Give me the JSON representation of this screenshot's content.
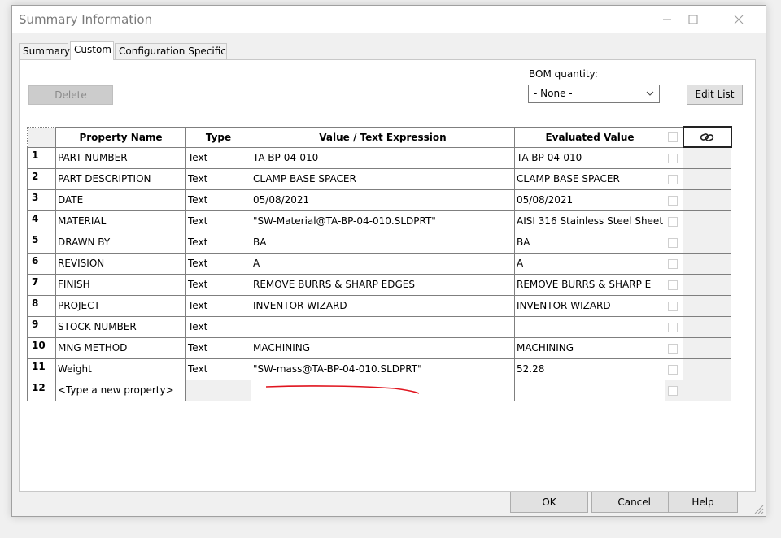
{
  "window": {
    "title": "Summary Information"
  },
  "tabs": [
    {
      "label": "Summary",
      "active": false
    },
    {
      "label": "Custom",
      "active": true
    },
    {
      "label": "Configuration Specific",
      "active": false
    }
  ],
  "toolbar": {
    "delete_label": "Delete",
    "bom_label": "BOM quantity:",
    "bom_value": "- None -",
    "edit_list_label": "Edit List"
  },
  "table": {
    "headers": {
      "num": "",
      "name": "Property Name",
      "type": "Type",
      "value": "Value / Text Expression",
      "evaluated": "Evaluated Value",
      "link_icon": "link-icon"
    },
    "rows": [
      {
        "num": "1",
        "name": "PART NUMBER",
        "type": "Text",
        "value": "TA-BP-04-010",
        "evaluated": "TA-BP-04-010"
      },
      {
        "num": "2",
        "name": "PART DESCRIPTION",
        "type": "Text",
        "value": "CLAMP BASE SPACER",
        "evaluated": "CLAMP BASE SPACER"
      },
      {
        "num": "3",
        "name": "DATE",
        "type": "Text",
        "value": "05/08/2021",
        "evaluated": "05/08/2021"
      },
      {
        "num": "4",
        "name": "MATERIAL",
        "type": "Text",
        "value": "\"SW-Material@TA-BP-04-010.SLDPRT\"",
        "evaluated": "AISI 316 Stainless Steel Sheet"
      },
      {
        "num": "5",
        "name": "DRAWN BY",
        "type": "Text",
        "value": "BA",
        "evaluated": "BA"
      },
      {
        "num": "6",
        "name": "REVISION",
        "type": "Text",
        "value": "A",
        "evaluated": "A"
      },
      {
        "num": "7",
        "name": "FINISH",
        "type": "Text",
        "value": "REMOVE BURRS & SHARP EDGES",
        "evaluated": "REMOVE BURRS & SHARP E"
      },
      {
        "num": "8",
        "name": "PROJECT",
        "type": "Text",
        "value": "INVENTOR WIZARD",
        "evaluated": "INVENTOR WIZARD"
      },
      {
        "num": "9",
        "name": "STOCK NUMBER",
        "type": "Text",
        "value": "",
        "evaluated": ""
      },
      {
        "num": "10",
        "name": "MNG METHOD",
        "type": "Text",
        "value": "MACHINING",
        "evaluated": "MACHINING"
      },
      {
        "num": "11",
        "name": "Weight",
        "type": "Text",
        "value": "\"SW-mass@TA-BP-04-010.SLDPRT\"",
        "evaluated": "52.28"
      },
      {
        "num": "12",
        "name": "<Type a new property>",
        "type": "",
        "value": "",
        "evaluated": ""
      }
    ]
  },
  "footer": {
    "ok_label": "OK",
    "cancel_label": "Cancel",
    "help_label": "Help"
  },
  "colors": {
    "annotation_underline": "#e0141e"
  }
}
